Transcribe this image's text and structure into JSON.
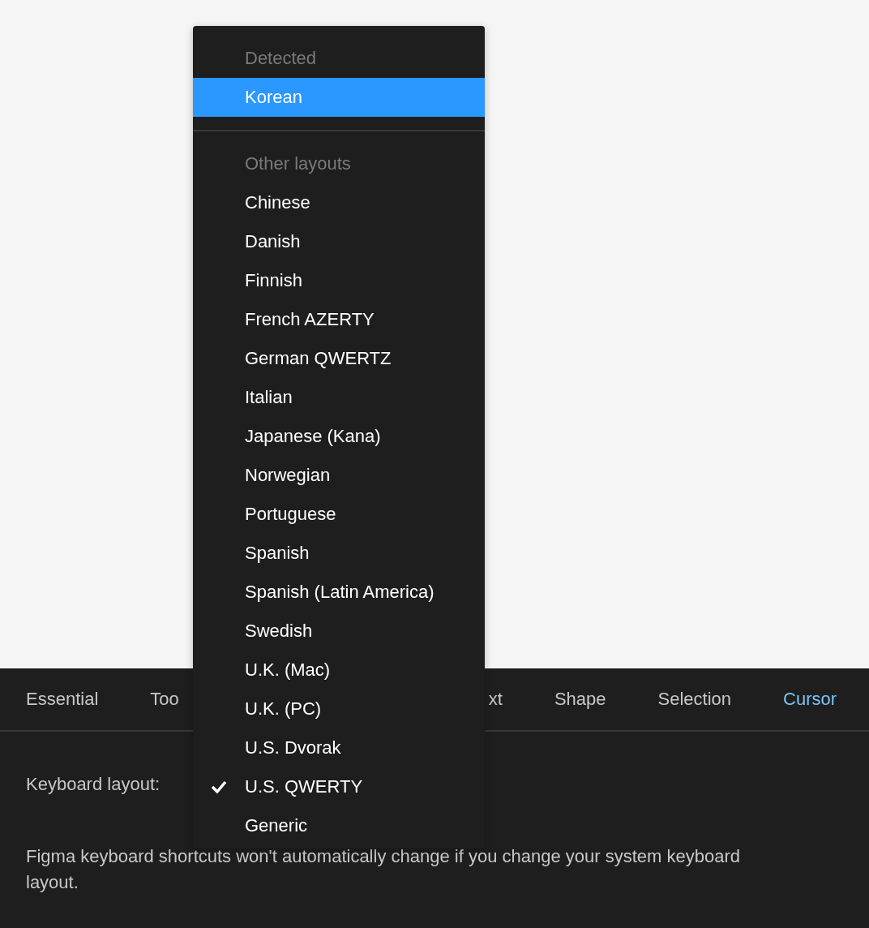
{
  "panel": {
    "tabs": [
      {
        "label": "Essential",
        "selected": false,
        "kind": "full"
      },
      {
        "label": "Too",
        "selected": false,
        "kind": "cut_right"
      },
      {
        "label": "xt",
        "selected": false,
        "kind": "cut_left"
      },
      {
        "label": "Shape",
        "selected": false,
        "kind": "full"
      },
      {
        "label": "Selection",
        "selected": false,
        "kind": "full"
      },
      {
        "label": "Cursor",
        "selected": true,
        "kind": "full"
      }
    ],
    "keyboard_layout_label": "Keyboard layout:",
    "note": "Figma keyboard shortcuts won't automatically change if you change your system keyboard layout."
  },
  "menu": {
    "sections": [
      {
        "heading": "Detected",
        "items": [
          {
            "label": "Korean",
            "selected": true,
            "checked": false
          }
        ]
      },
      {
        "heading": "Other layouts",
        "items": [
          {
            "label": "Chinese",
            "selected": false,
            "checked": false
          },
          {
            "label": "Danish",
            "selected": false,
            "checked": false
          },
          {
            "label": "Finnish",
            "selected": false,
            "checked": false
          },
          {
            "label": "French AZERTY",
            "selected": false,
            "checked": false
          },
          {
            "label": "German QWERTZ",
            "selected": false,
            "checked": false
          },
          {
            "label": "Italian",
            "selected": false,
            "checked": false
          },
          {
            "label": "Japanese (Kana)",
            "selected": false,
            "checked": false
          },
          {
            "label": "Norwegian",
            "selected": false,
            "checked": false
          },
          {
            "label": "Portuguese",
            "selected": false,
            "checked": false
          },
          {
            "label": "Spanish",
            "selected": false,
            "checked": false
          },
          {
            "label": "Spanish (Latin America)",
            "selected": false,
            "checked": false
          },
          {
            "label": "Swedish",
            "selected": false,
            "checked": false
          },
          {
            "label": "U.K. (Mac)",
            "selected": false,
            "checked": false
          },
          {
            "label": "U.K. (PC)",
            "selected": false,
            "checked": false
          },
          {
            "label": "U.S. Dvorak",
            "selected": false,
            "checked": false
          },
          {
            "label": "U.S. QWERTY",
            "selected": false,
            "checked": true
          },
          {
            "label": "Generic",
            "selected": false,
            "checked": false
          }
        ]
      }
    ]
  }
}
